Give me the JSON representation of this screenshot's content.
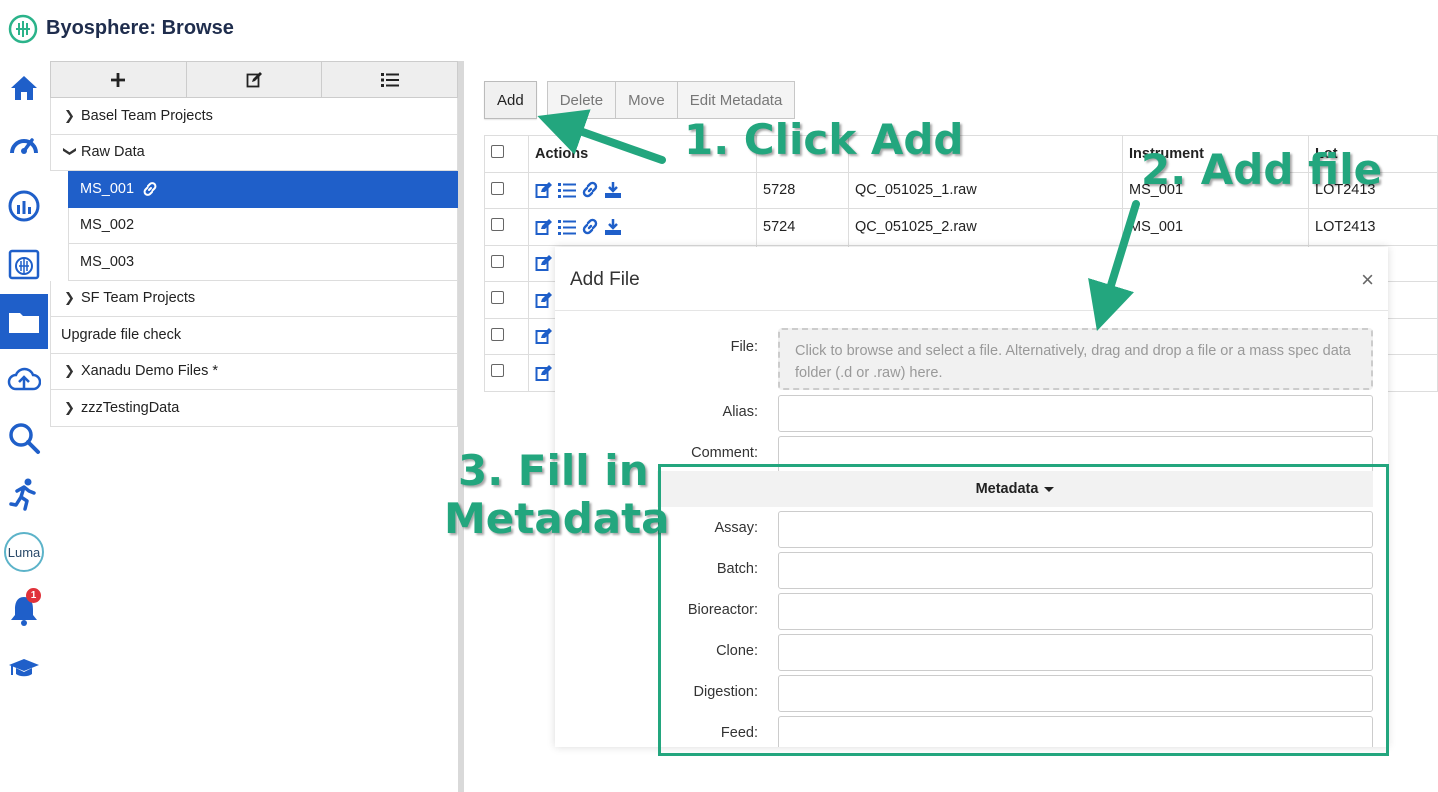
{
  "app": {
    "title": "Byosphere: Browse"
  },
  "rail": {
    "items": [
      {
        "icon": "home-icon"
      },
      {
        "icon": "dashboard-icon"
      },
      {
        "icon": "analytics-icon"
      },
      {
        "icon": "app-window-icon"
      },
      {
        "icon": "folder-icon",
        "active": true
      },
      {
        "icon": "cloud-upload-icon"
      },
      {
        "icon": "search-icon"
      },
      {
        "icon": "running-icon"
      },
      {
        "icon": "luma-icon",
        "label": "Luma"
      },
      {
        "icon": "bell-icon",
        "badge": "1"
      },
      {
        "icon": "graduation-cap-icon"
      }
    ]
  },
  "tree": {
    "toolbar": [
      {
        "icon": "plus-icon"
      },
      {
        "icon": "edit-icon"
      },
      {
        "icon": "list-icon"
      }
    ],
    "items": [
      {
        "label": "Basel Team Projects",
        "expanded": false
      },
      {
        "label": "Raw Data",
        "expanded": true
      },
      {
        "label": "MS_001",
        "selected": true,
        "child": true
      },
      {
        "label": "MS_002",
        "child": true
      },
      {
        "label": "MS_003",
        "child": true
      },
      {
        "label": "SF Team Projects",
        "expanded": false
      },
      {
        "label": "Upgrade file check"
      },
      {
        "label": "Xanadu Demo Files *",
        "expanded": false
      },
      {
        "label": "zzzTestingData",
        "expanded": false
      }
    ]
  },
  "toolbar": {
    "add_label": "Add",
    "delete_label": "Delete",
    "move_label": "Move",
    "edit_metadata_label": "Edit Metadata"
  },
  "table": {
    "headers": {
      "actions": "Actions",
      "instrument": "Instrument",
      "lot": "Lot"
    },
    "rows": [
      {
        "id": "5728",
        "name": "QC_051025_1.raw",
        "instrument": "MS_001",
        "lot": "LOT2413"
      },
      {
        "id": "5724",
        "name": "QC_051025_2.raw",
        "instrument": "MS_001",
        "lot": "LOT2413"
      }
    ]
  },
  "modal": {
    "title": "Add File",
    "close": "×",
    "file_label": "File:",
    "dropzone_text": "Click to browse and select a file. Alternatively, drag and drop a file or a mass spec data folder (.d or .raw) here.",
    "alias_label": "Alias:",
    "comment_label": "Comment:",
    "metadata_label": "Metadata",
    "metadata_fields": [
      "Assay:",
      "Batch:",
      "Bioreactor:",
      "Clone:",
      "Digestion:",
      "Feed:"
    ]
  },
  "annotations": {
    "step1": "1. Click Add",
    "step2": "2. Add file",
    "step3_line1": "3. Fill in",
    "step3_line2": "Metadata",
    "color": "#23a67e"
  }
}
